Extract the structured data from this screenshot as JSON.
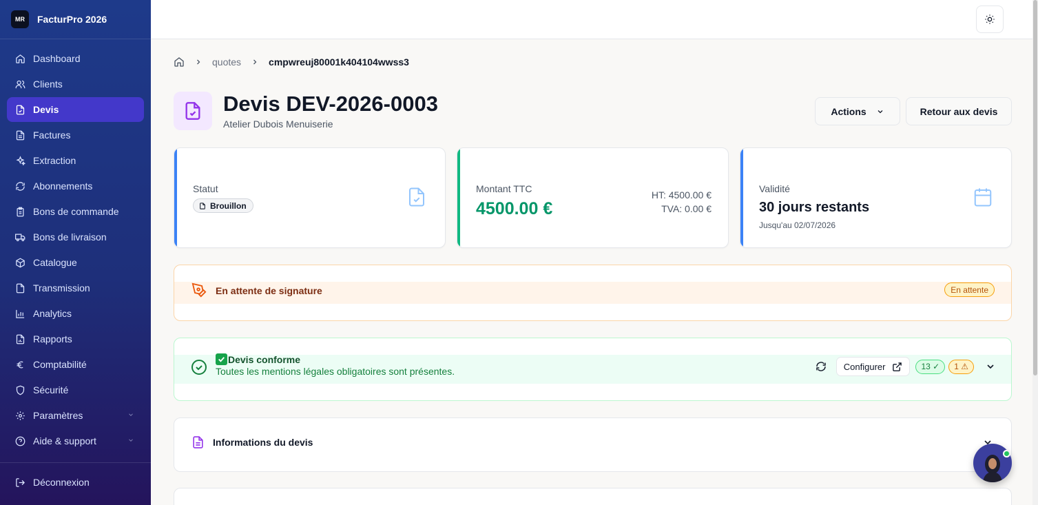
{
  "app": {
    "logo_text": "MR",
    "name": "FacturPro 2026"
  },
  "sidebar": {
    "items": [
      {
        "label": "Dashboard",
        "icon": "home-icon"
      },
      {
        "label": "Clients",
        "icon": "users-icon"
      },
      {
        "label": "Devis",
        "icon": "file-check-icon",
        "active": true
      },
      {
        "label": "Factures",
        "icon": "file-text-icon"
      },
      {
        "label": "Extraction",
        "icon": "sparkles-icon"
      },
      {
        "label": "Abonnements",
        "icon": "refresh-icon"
      },
      {
        "label": "Bons de commande",
        "icon": "clipboard-icon"
      },
      {
        "label": "Bons de livraison",
        "icon": "truck-icon"
      },
      {
        "label": "Catalogue",
        "icon": "package-icon"
      },
      {
        "label": "Transmission",
        "icon": "send-icon"
      },
      {
        "label": "Analytics",
        "icon": "bar-chart-icon"
      },
      {
        "label": "Rapports",
        "icon": "report-icon"
      },
      {
        "label": "Comptabilité",
        "icon": "euro-icon"
      },
      {
        "label": "Sécurité",
        "icon": "shield-icon"
      },
      {
        "label": "Paramètres",
        "icon": "gear-icon"
      },
      {
        "label": "Aide & support",
        "icon": "help-icon"
      }
    ],
    "logout": "Déconnexion"
  },
  "breadcrumb": {
    "section": "quotes",
    "current": "cmpwreuj80001k404104wwss3"
  },
  "header": {
    "title": "Devis DEV-2026-0003",
    "client": "Atelier Dubois Menuiserie",
    "actions_label": "Actions",
    "back_label": "Retour aux devis"
  },
  "cards": {
    "status": {
      "label": "Statut",
      "value": "Brouillon"
    },
    "amount": {
      "label": "Montant TTC",
      "value": "4500.00 €",
      "ht": "HT: 4500.00 €",
      "tva": "TVA: 0.00 €"
    },
    "validity": {
      "label": "Validité",
      "value": "30 jours restants",
      "until": "Jusqu'au 02/07/2026"
    }
  },
  "signature": {
    "text": "En attente de signature",
    "badge": "En attente"
  },
  "compliance": {
    "title": "Devis conforme",
    "subtitle": "Toutes les mentions légales obligatoires sont présentes.",
    "configure_label": "Configurer",
    "ok_count": "13 ✓",
    "warn_count": "1 ⚠"
  },
  "info_section": {
    "title": "Informations du devis"
  },
  "colors": {
    "accent": "#4338ca",
    "success": "#059669",
    "warning": "#f59e0b",
    "info_bar": "#3b82f6"
  }
}
